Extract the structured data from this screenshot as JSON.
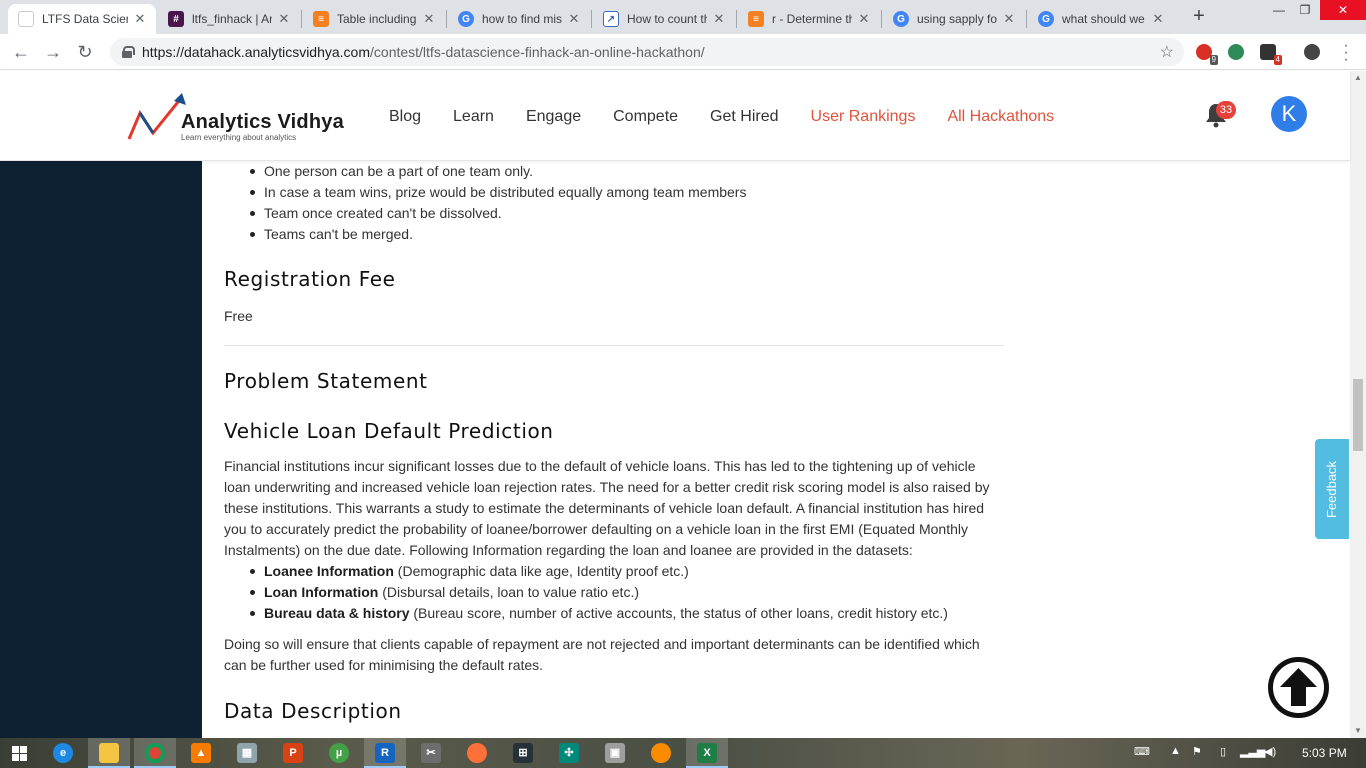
{
  "browser": {
    "tabs": [
      {
        "title": "LTFS Data Scien",
        "icon": "analytics-vidhya-favicon",
        "color": "#ffffff"
      },
      {
        "title": "ltfs_finhack | An",
        "icon": "slack-icon",
        "color": "#4a154b"
      },
      {
        "title": "Table including",
        "icon": "stackoverflow-icon",
        "color": "#f48024"
      },
      {
        "title": "how to find mis",
        "icon": "google-icon",
        "color": "#4285f4"
      },
      {
        "title": "How to count th",
        "icon": "chart-favicon",
        "color": "#3b6db3"
      },
      {
        "title": "r - Determine th",
        "icon": "stackoverflow-icon",
        "color": "#f48024"
      },
      {
        "title": "using sapply fo",
        "icon": "google-icon",
        "color": "#4285f4"
      },
      {
        "title": "what should we",
        "icon": "google-icon",
        "color": "#4285f4"
      }
    ],
    "url_host": "https://datahack.analyticsvidhya.com",
    "url_path": "/contest/ltfs-datascience-finhack-an-online-hackathon/",
    "extension_badges": [
      "9",
      "4"
    ]
  },
  "site": {
    "logo_name": "Analytics Vidhya",
    "logo_tagline": "Learn everything about analytics",
    "nav": [
      "Blog",
      "Learn",
      "Engage",
      "Compete",
      "Get Hired",
      "User Rankings",
      "All Hackathons"
    ],
    "notification_count": "33",
    "avatar_letter": "K",
    "accent": "#e0533a"
  },
  "content": {
    "team_rules": [
      "One person can be a part of one team only.",
      "In case a team wins, prize would be distributed equally among team members",
      "Team once created can't be dissolved.",
      "Teams can't be merged."
    ],
    "registration_heading": "Registration Fee",
    "registration_value": "Free",
    "problem_heading": "Problem Statement",
    "vehicle_heading": "Vehicle Loan Default Prediction",
    "intro_paragraph": "Financial institutions incur significant losses due to the default of vehicle loans. This has led to the tightening up of vehicle loan underwriting and increased vehicle loan rejection rates. The need for a better credit risk scoring model is also raised by these institutions. This warrants a study to estimate the determinants of vehicle loan default. A financial institution has hired you to accurately predict the probability of loanee/borrower defaulting on a vehicle loan in the first EMI (Equated Monthly Instalments) on the due date. Following Information regarding the loan and loanee are provided in the datasets:",
    "data_items": [
      {
        "bold": "Loanee Information",
        "rest": " (Demographic data like age, Identity proof etc.)"
      },
      {
        "bold": "Loan Information",
        "rest": " (Disbursal details, loan to value ratio etc.)"
      },
      {
        "bold": "Bureau data & history",
        "rest": " (Bureau score, number of active accounts, the status of other loans, credit history etc.)"
      }
    ],
    "closing_paragraph": "Doing so will ensure that clients capable of repayment are not rejected and important determinants can be identified which can be further used for minimising the default rates.",
    "data_heading": "Data Description"
  },
  "feedback_label": "Feedback",
  "taskbar": {
    "time": "5:03 PM"
  }
}
